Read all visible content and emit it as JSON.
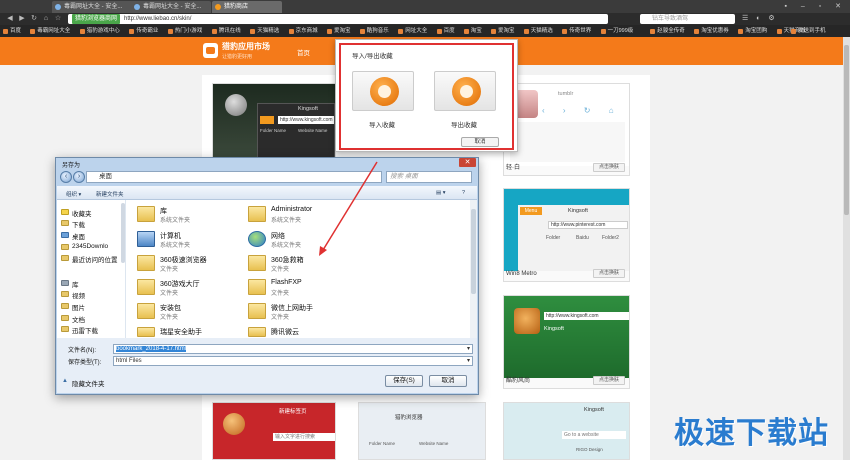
{
  "browser": {
    "tabs": [
      {
        "label": "毒霸网址大全 - 安全..."
      },
      {
        "label": "毒霸网址大全 - 安全..."
      },
      {
        "label": "猎豹商店"
      }
    ],
    "address_badge": "猎豹浏览器商网",
    "url": "http://www.liebao.cn/skin/",
    "search_placeholder": "钻车导致酒驾",
    "bookmarks": [
      "百度",
      "毒霸网址大全",
      "猎豹游戏中心",
      "传奇霸业",
      "热门小游戏",
      "腾讯在线",
      "天猫精选",
      "京东商城",
      "爱淘宝",
      "酷狗音乐",
      "网址大全",
      "百度",
      "淘宝",
      "爱淘宝",
      "天猫精选",
      "传奇世界",
      "一刀999级",
      "赵骏全传奇",
      "淘宝优惠券",
      "淘宝团购",
      "天猫商城",
      "发送到手机"
    ]
  },
  "site": {
    "title": "猎豹应用市场",
    "subtitle": "让猎豹更好用",
    "nav_home": "首页"
  },
  "skins": [
    {
      "label": "轻·白",
      "button": "点击换肤"
    },
    {
      "label": "Win8 Metro",
      "button": "点击换肤"
    },
    {
      "label": "酷豹风尚",
      "button": "点击换肤"
    }
  ],
  "skin_previews": {
    "kingsoft_brand": "Kingsoft",
    "url_sample": "http://www.kingsoft.com",
    "url_sample_2": "http://www.pinterest.com",
    "tumblr": "tumblr",
    "menu": "Menu",
    "folder_name": "Folder Name",
    "website_name": "Website Name",
    "folder": "Folder",
    "baidu": "Baidu",
    "folder2": "Folder2",
    "new_tab": "新建标签页",
    "input_hint": "输入文字进行搜索",
    "liebao_browser": "猎豹浏览器",
    "rigo": "RIGO Design",
    "goto": "Go to a website"
  },
  "import_dialog": {
    "title": "导入/导出收藏",
    "import_label": "导入收藏",
    "export_label": "导出收藏",
    "cancel": "取消"
  },
  "save_dialog": {
    "title": "另存为",
    "path": "桌面",
    "search_placeholder": "搜索 桌面",
    "toolbar": {
      "organize": "组织 ▾",
      "new_folder": "新建文件夹"
    },
    "tree": [
      {
        "label": "收藏夹",
        "icon": "star"
      },
      {
        "label": "下载",
        "icon": "folder"
      },
      {
        "label": "桌面",
        "icon": "desktop"
      },
      {
        "label": "2345Downlo",
        "icon": "folder"
      },
      {
        "label": "最近访问的位置",
        "icon": "folder"
      },
      {
        "label": "库",
        "icon": "library"
      },
      {
        "label": "视频",
        "icon": "folder"
      },
      {
        "label": "图片",
        "icon": "folder"
      },
      {
        "label": "文档",
        "icon": "folder"
      },
      {
        "label": "迅雷下载",
        "icon": "folder"
      },
      {
        "label": "音乐",
        "icon": "folder"
      }
    ],
    "files": [
      {
        "name": "库",
        "sub": "系统文件夹",
        "icon": "folder"
      },
      {
        "name": "Administrator",
        "sub": "系统文件夹",
        "icon": "user"
      },
      {
        "name": "计算机",
        "sub": "系统文件夹",
        "icon": "pc"
      },
      {
        "name": "网络",
        "sub": "系统文件夹",
        "icon": "net"
      },
      {
        "name": "360极速浏览器",
        "sub": "文件夹",
        "icon": "folder"
      },
      {
        "name": "360急救箱",
        "sub": "文件夹",
        "icon": "folder"
      },
      {
        "name": "360游戏大厅",
        "sub": "文件夹",
        "icon": "folder"
      },
      {
        "name": "FlashFXP",
        "sub": "文件夹",
        "icon": "folder"
      },
      {
        "name": "安装包",
        "sub": "文件夹",
        "icon": "folder"
      },
      {
        "name": "微信上网助手",
        "sub": "文件夹",
        "icon": "folder"
      },
      {
        "name": "瑞星安全助手",
        "sub": "",
        "icon": "folder"
      },
      {
        "name": "腾讯微云",
        "sub": "",
        "icon": "folder"
      }
    ],
    "filename_label": "文件名(N):",
    "filename_value": "bookmark_2018-4-17.html",
    "filetype_label": "保存类型(T):",
    "filetype_value": "html Files",
    "hide_folders": "隐藏文件夹",
    "save_button": "保存(S)",
    "cancel_button": "取消"
  },
  "watermark": "极速下载站"
}
